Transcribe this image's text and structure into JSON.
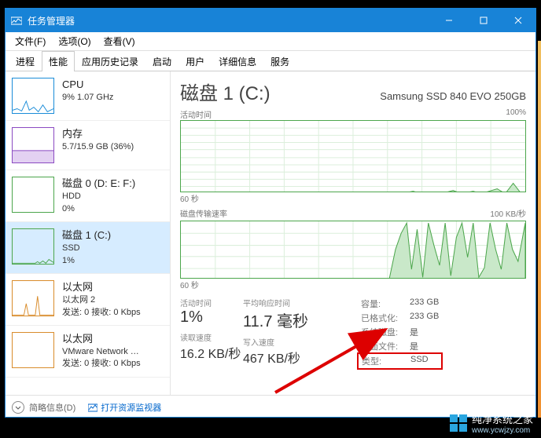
{
  "window": {
    "title": "任务管理器"
  },
  "menu": {
    "file": "文件(F)",
    "options": "选项(O)",
    "view": "查看(V)"
  },
  "tabs": {
    "processes": "进程",
    "performance": "性能",
    "app_history": "应用历史记录",
    "startup": "启动",
    "users": "用户",
    "details": "详细信息",
    "services": "服务"
  },
  "sidebar": {
    "cpu": {
      "name": "CPU",
      "sub1": "9% 1.07 GHz",
      "sub2": ""
    },
    "mem": {
      "name": "内存",
      "sub1": "5.7/15.9 GB (36%)",
      "sub2": ""
    },
    "disk0": {
      "name": "磁盘 0 (D: E: F:)",
      "sub1": "HDD",
      "sub2": "0%"
    },
    "disk1": {
      "name": "磁盘 1 (C:)",
      "sub1": "SSD",
      "sub2": "1%"
    },
    "eth1": {
      "name": "以太网",
      "sub1": "以太网 2",
      "sub2": "发送: 0 接收: 0 Kbps"
    },
    "eth2": {
      "name": "以太网",
      "sub1": "VMware Network …",
      "sub2": "发送: 0 接收: 0 Kbps"
    }
  },
  "main": {
    "title": "磁盘 1 (C:)",
    "model": "Samsung SSD 840 EVO 250GB",
    "chart1": {
      "label_left": "活动时间",
      "label_right": "100%",
      "axis": "60 秒"
    },
    "chart2": {
      "label_left": "磁盘传输速率",
      "label_right": "100 KB/秒",
      "axis": "60 秒"
    },
    "stats": {
      "active_time_label": "活动时间",
      "active_time": "1%",
      "avg_resp_label": "平均响应时间",
      "avg_resp": "11.7 毫秒",
      "read_label": "读取速度",
      "read": "16.2 KB/秒",
      "write_label": "写入速度",
      "write": "467 KB/秒"
    },
    "right": {
      "capacity_k": "容量:",
      "capacity_v": "233 GB",
      "formatted_k": "已格式化:",
      "formatted_v": "233 GB",
      "sysdisk_k": "系统磁盘:",
      "sysdisk_v": "是",
      "pagefile_k": "页面文件:",
      "pagefile_v": "是",
      "type_k": "类型:",
      "type_v": "SSD"
    }
  },
  "footer": {
    "less": "简略信息(D)",
    "resmon": "打开资源监视器"
  },
  "watermark": {
    "brand": "纯净系统之家",
    "url": "www.ycwjzy.com"
  },
  "chart_data": [
    {
      "type": "area",
      "title": "活动时间",
      "ylabel": "%",
      "ylim": [
        0,
        100
      ],
      "xlabel": "60 秒",
      "values": [
        1,
        1,
        2,
        1,
        1,
        2,
        1,
        1,
        1,
        1,
        2,
        1,
        1,
        1,
        2,
        1,
        1,
        1,
        1,
        2,
        1,
        3,
        2,
        1,
        1,
        2,
        1,
        1,
        2,
        3,
        1,
        1,
        2,
        1,
        1,
        1,
        1,
        2,
        1,
        2,
        3,
        5,
        2,
        4,
        2,
        1,
        1,
        2,
        1,
        2,
        1,
        1,
        2,
        1,
        6,
        3,
        1,
        15,
        2,
        1
      ]
    },
    {
      "type": "area",
      "title": "磁盘传输速率",
      "ylabel": "KB/秒",
      "ylim": [
        0,
        100
      ],
      "xlabel": "60 秒",
      "values": [
        1,
        1,
        1,
        1,
        1,
        1,
        1,
        1,
        1,
        1,
        1,
        1,
        1,
        1,
        1,
        1,
        1,
        1,
        1,
        1,
        1,
        1,
        1,
        1,
        1,
        1,
        1,
        1,
        1,
        1,
        1,
        1,
        1,
        1,
        1,
        1,
        1,
        1,
        1,
        50,
        70,
        95,
        20,
        80,
        10,
        95,
        60,
        30,
        95,
        10,
        70,
        95,
        40,
        95,
        5,
        20,
        95,
        50,
        20,
        95
      ]
    }
  ],
  "colors": {
    "accent": "#1883d7",
    "disk_green": "#4ca64c"
  }
}
